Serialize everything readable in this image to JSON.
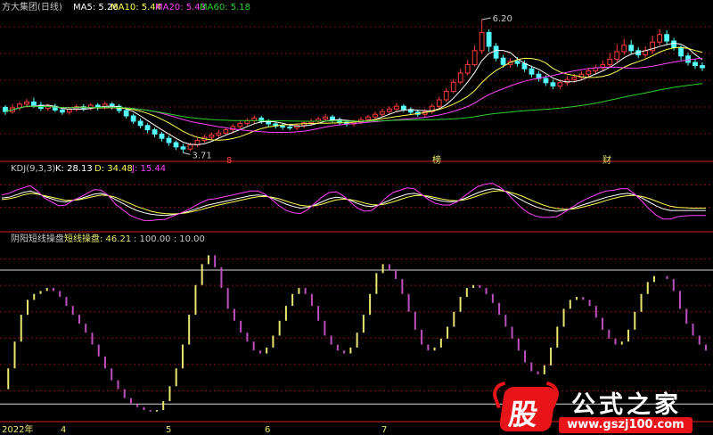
{
  "colors": {
    "up": "#ff3c3c",
    "down": "#54ffff",
    "ma5": "#ffffff",
    "ma10": "#ffff55",
    "ma20": "#ff44ff",
    "ma60": "#2ad02a",
    "k": "#ffffff",
    "d": "#ffff55",
    "j": "#ff44ff",
    "osc_up": "#e8e870",
    "osc_down": "#c050c0",
    "grid": "#8a1010",
    "text": "#c8c8c8"
  },
  "main_legend": {
    "name": "方大集团(日线)",
    "ma5": "MA5: 5.26",
    "ma10": "MA10: 5.44",
    "ma20": "MA20: 5.43",
    "ma60": "MA60: 5.18"
  },
  "kdj_legend": {
    "name": "KDJ(9,3,3)",
    "k": "K: 28.13",
    "d": "D: 34.48",
    "j": "J: 15.44"
  },
  "osc_legend": {
    "name": "阴阳短线操盘",
    "series": "短线操盘: 46.21",
    "levels": ": 100.00 : 10.00"
  },
  "markers": {
    "high": "6.20",
    "low": "3.71",
    "event_1": "8",
    "event_2": "榜",
    "event_3": "财"
  },
  "xaxis": {
    "year": "2022年",
    "ticks": [
      "4",
      "5",
      "6",
      "7"
    ]
  },
  "watermark": {
    "logo_char": "股",
    "title": "公式之家",
    "url": "www.gszj100.com"
  },
  "chart_data": [
    {
      "type": "candlestick",
      "title": "方大集团(日线)",
      "xlabel": "",
      "ylabel": "",
      "ylim": [
        3.6,
        6.3
      ],
      "grid": true,
      "annotations": [
        {
          "text": "6.20",
          "at": "highest high",
          "value": 6.2
        },
        {
          "text": "3.71",
          "at": "lowest low",
          "value": 3.71
        }
      ],
      "candles": [
        [
          4.56,
          4.48,
          4.42,
          4.6
        ],
        [
          4.48,
          4.55,
          4.44,
          4.62
        ],
        [
          4.55,
          4.62,
          4.5,
          4.66
        ],
        [
          4.62,
          4.66,
          4.56,
          4.72
        ],
        [
          4.66,
          4.6,
          4.55,
          4.74
        ],
        [
          4.6,
          4.54,
          4.49,
          4.66
        ],
        [
          4.54,
          4.58,
          4.49,
          4.63
        ],
        [
          4.58,
          4.51,
          4.47,
          4.63
        ],
        [
          4.51,
          4.47,
          4.42,
          4.55
        ],
        [
          4.47,
          4.52,
          4.42,
          4.56
        ],
        [
          4.52,
          4.57,
          4.48,
          4.62
        ],
        [
          4.57,
          4.54,
          4.49,
          4.62
        ],
        [
          4.54,
          4.6,
          4.5,
          4.64
        ],
        [
          4.6,
          4.56,
          4.5,
          4.64
        ],
        [
          4.56,
          4.62,
          4.52,
          4.67
        ],
        [
          4.62,
          4.58,
          4.52,
          4.66
        ],
        [
          4.58,
          4.5,
          4.45,
          4.62
        ],
        [
          4.5,
          4.4,
          4.35,
          4.54
        ],
        [
          4.4,
          4.3,
          4.25,
          4.44
        ],
        [
          4.3,
          4.22,
          4.17,
          4.35
        ],
        [
          4.22,
          4.14,
          4.08,
          4.26
        ],
        [
          4.14,
          4.06,
          4.0,
          4.18
        ],
        [
          4.06,
          3.98,
          3.92,
          4.1
        ],
        [
          3.98,
          3.9,
          3.84,
          4.03
        ],
        [
          3.9,
          3.82,
          3.76,
          3.94
        ],
        [
          3.82,
          3.78,
          3.71,
          3.88
        ],
        [
          3.78,
          3.86,
          3.74,
          3.9
        ],
        [
          3.86,
          3.94,
          3.82,
          3.98
        ],
        [
          3.94,
          4.0,
          3.9,
          4.05
        ],
        [
          4.0,
          4.04,
          3.96,
          4.09
        ],
        [
          4.04,
          4.08,
          3.99,
          4.14
        ],
        [
          4.08,
          4.14,
          4.03,
          4.19
        ],
        [
          4.14,
          4.2,
          4.09,
          4.25
        ],
        [
          4.2,
          4.26,
          4.15,
          4.31
        ],
        [
          4.26,
          4.31,
          4.21,
          4.36
        ],
        [
          4.31,
          4.36,
          4.26,
          4.41
        ],
        [
          4.36,
          4.3,
          4.25,
          4.4
        ],
        [
          4.3,
          4.25,
          4.2,
          4.34
        ],
        [
          4.25,
          4.21,
          4.16,
          4.29
        ],
        [
          4.21,
          4.19,
          4.14,
          4.26
        ],
        [
          4.19,
          4.18,
          4.13,
          4.23
        ],
        [
          4.18,
          4.22,
          4.13,
          4.26
        ],
        [
          4.22,
          4.27,
          4.17,
          4.31
        ],
        [
          4.27,
          4.3,
          4.22,
          4.35
        ],
        [
          4.3,
          4.34,
          4.25,
          4.39
        ],
        [
          4.34,
          4.38,
          4.29,
          4.44
        ],
        [
          4.38,
          4.33,
          4.28,
          4.42
        ],
        [
          4.33,
          4.28,
          4.23,
          4.37
        ],
        [
          4.28,
          4.25,
          4.2,
          4.32
        ],
        [
          4.25,
          4.28,
          4.2,
          4.33
        ],
        [
          4.28,
          4.33,
          4.24,
          4.38
        ],
        [
          4.33,
          4.38,
          4.28,
          4.42
        ],
        [
          4.38,
          4.43,
          4.33,
          4.48
        ],
        [
          4.43,
          4.48,
          4.38,
          4.54
        ],
        [
          4.48,
          4.53,
          4.43,
          4.58
        ],
        [
          4.53,
          4.58,
          4.48,
          4.64
        ],
        [
          4.58,
          4.52,
          4.47,
          4.62
        ],
        [
          4.52,
          4.47,
          4.42,
          4.56
        ],
        [
          4.47,
          4.43,
          4.38,
          4.51
        ],
        [
          4.43,
          4.48,
          4.38,
          4.53
        ],
        [
          4.48,
          4.58,
          4.44,
          4.63
        ],
        [
          4.58,
          4.7,
          4.54,
          4.76
        ],
        [
          4.7,
          4.86,
          4.66,
          4.92
        ],
        [
          4.86,
          5.03,
          4.82,
          5.09
        ],
        [
          5.03,
          5.2,
          4.99,
          5.28
        ],
        [
          5.2,
          5.36,
          5.16,
          5.45
        ],
        [
          5.36,
          5.62,
          5.32,
          5.72
        ],
        [
          5.62,
          5.96,
          5.56,
          6.2
        ],
        [
          5.96,
          5.7,
          5.6,
          6.02
        ],
        [
          5.7,
          5.48,
          5.42,
          5.76
        ],
        [
          5.48,
          5.36,
          5.3,
          5.54
        ],
        [
          5.36,
          5.42,
          5.3,
          5.48
        ],
        [
          5.42,
          5.38,
          5.32,
          5.5
        ],
        [
          5.38,
          5.28,
          5.22,
          5.44
        ],
        [
          5.28,
          5.18,
          5.12,
          5.34
        ],
        [
          5.18,
          5.1,
          5.04,
          5.24
        ],
        [
          5.1,
          5.02,
          4.96,
          5.16
        ],
        [
          5.02,
          4.96,
          4.9,
          5.08
        ],
        [
          4.96,
          5.02,
          4.9,
          5.08
        ],
        [
          5.02,
          5.08,
          4.96,
          5.14
        ],
        [
          5.08,
          5.12,
          5.02,
          5.18
        ],
        [
          5.12,
          5.18,
          5.06,
          5.24
        ],
        [
          5.18,
          5.24,
          5.12,
          5.3
        ],
        [
          5.24,
          5.3,
          5.18,
          5.36
        ],
        [
          5.3,
          5.36,
          5.24,
          5.44
        ],
        [
          5.36,
          5.46,
          5.3,
          5.58
        ],
        [
          5.46,
          5.6,
          5.4,
          5.74
        ],
        [
          5.6,
          5.72,
          5.54,
          5.84
        ],
        [
          5.72,
          5.62,
          5.56,
          5.82
        ],
        [
          5.62,
          5.54,
          5.48,
          5.68
        ],
        [
          5.54,
          5.62,
          5.48,
          5.7
        ],
        [
          5.62,
          5.78,
          5.56,
          5.9
        ],
        [
          5.78,
          5.92,
          5.72,
          6.02
        ],
        [
          5.92,
          5.8,
          5.74,
          6.0
        ],
        [
          5.8,
          5.68,
          5.62,
          5.86
        ],
        [
          5.68,
          5.52,
          5.44,
          5.72
        ],
        [
          5.52,
          5.4,
          5.34,
          5.58
        ],
        [
          5.4,
          5.34,
          5.28,
          5.46
        ],
        [
          5.34,
          5.3,
          5.24,
          5.4
        ]
      ],
      "series": [
        {
          "name": "MA5",
          "period": 5
        },
        {
          "name": "MA10",
          "period": 10
        },
        {
          "name": "MA20",
          "period": 20
        },
        {
          "name": "MA60",
          "period": 60
        }
      ]
    },
    {
      "type": "line",
      "title": "KDJ(9,3,3)",
      "xlabel": "",
      "ylabel": "",
      "ylim": [
        -20,
        120
      ],
      "grid": true,
      "series": [
        {
          "name": "K",
          "values": [
            60,
            62,
            68,
            74,
            78,
            72,
            64,
            58,
            52,
            50,
            54,
            58,
            64,
            70,
            72,
            66,
            56,
            46,
            36,
            28,
            22,
            18,
            16,
            15,
            17,
            20,
            24,
            30,
            36,
            42,
            46,
            50,
            54,
            58,
            62,
            66,
            68,
            66,
            60,
            52,
            44,
            38,
            34,
            36,
            42,
            50,
            58,
            62,
            60,
            54,
            46,
            40,
            38,
            42,
            50,
            58,
            64,
            70,
            72,
            68,
            62,
            56,
            52,
            50,
            52,
            58,
            66,
            74,
            80,
            84,
            82,
            76,
            66,
            56,
            46,
            38,
            32,
            28,
            26,
            28,
            32,
            38,
            44,
            50,
            56,
            62,
            66,
            70,
            72,
            68,
            60,
            50,
            40,
            32,
            28,
            28,
            28,
            28,
            28,
            28
          ]
        },
        {
          "name": "D",
          "values": [
            56,
            58,
            62,
            68,
            72,
            70,
            66,
            62,
            58,
            54,
            54,
            56,
            60,
            64,
            68,
            66,
            62,
            54,
            46,
            38,
            32,
            26,
            22,
            20,
            19,
            20,
            22,
            26,
            30,
            35,
            40,
            44,
            48,
            52,
            56,
            60,
            63,
            64,
            62,
            58,
            52,
            46,
            41,
            39,
            40,
            44,
            50,
            55,
            57,
            56,
            52,
            47,
            43,
            42,
            45,
            50,
            56,
            62,
            66,
            67,
            65,
            61,
            57,
            54,
            53,
            55,
            60,
            66,
            72,
            77,
            79,
            77,
            72,
            66,
            58,
            50,
            43,
            37,
            33,
            31,
            31,
            34,
            38,
            43,
            48,
            54,
            59,
            63,
            66,
            67,
            64,
            59,
            52,
            45,
            39,
            36,
            35,
            34,
            34,
            34
          ]
        },
        {
          "name": "J",
          "values": [
            68,
            72,
            80,
            86,
            92,
            78,
            60,
            50,
            40,
            42,
            54,
            62,
            72,
            82,
            80,
            66,
            44,
            30,
            16,
            8,
            2,
            2,
            4,
            5,
            13,
            20,
            28,
            38,
            48,
            56,
            58,
            62,
            66,
            70,
            74,
            78,
            78,
            70,
            56,
            40,
            28,
            22,
            20,
            30,
            46,
            62,
            74,
            76,
            66,
            50,
            34,
            26,
            28,
            42,
            60,
            74,
            80,
            86,
            84,
            70,
            56,
            46,
            42,
            42,
            50,
            64,
            78,
            90,
            96,
            98,
            88,
            74,
            54,
            36,
            22,
            14,
            10,
            10,
            12,
            22,
            34,
            46,
            56,
            64,
            72,
            78,
            80,
            84,
            84,
            70,
            52,
            32,
            16,
            6,
            6,
            12,
            14,
            15,
            15,
            15
          ]
        }
      ]
    },
    {
      "type": "line",
      "title": "阴阳短线操盘",
      "xlabel": "",
      "ylabel": "",
      "ylim": [
        0,
        115
      ],
      "grid": true,
      "reference_lines": [
        100,
        10
      ],
      "series": [
        {
          "name": "短线操盘",
          "values": [
            20,
            34,
            52,
            70,
            80,
            84,
            86,
            88,
            86,
            82,
            76,
            70,
            64,
            58,
            50,
            42,
            34,
            26,
            20,
            14,
            10,
            8,
            6,
            5,
            6,
            12,
            22,
            34,
            50,
            70,
            90,
            104,
            110,
            102,
            88,
            74,
            66,
            58,
            52,
            46,
            44,
            48,
            56,
            66,
            76,
            84,
            88,
            84,
            76,
            66,
            56,
            50,
            46,
            44,
            48,
            58,
            70,
            84,
            98,
            104,
            100,
            94,
            84,
            72,
            60,
            50,
            46,
            48,
            54,
            62,
            72,
            82,
            88,
            90,
            88,
            84,
            78,
            70,
            62,
            54,
            46,
            38,
            32,
            30,
            36,
            48,
            62,
            74,
            80,
            82,
            80,
            76,
            68,
            60,
            54,
            50,
            52,
            60,
            72,
            84,
            92,
            96,
            96,
            94,
            86,
            74,
            64,
            56,
            50,
            46
          ]
        }
      ]
    }
  ]
}
